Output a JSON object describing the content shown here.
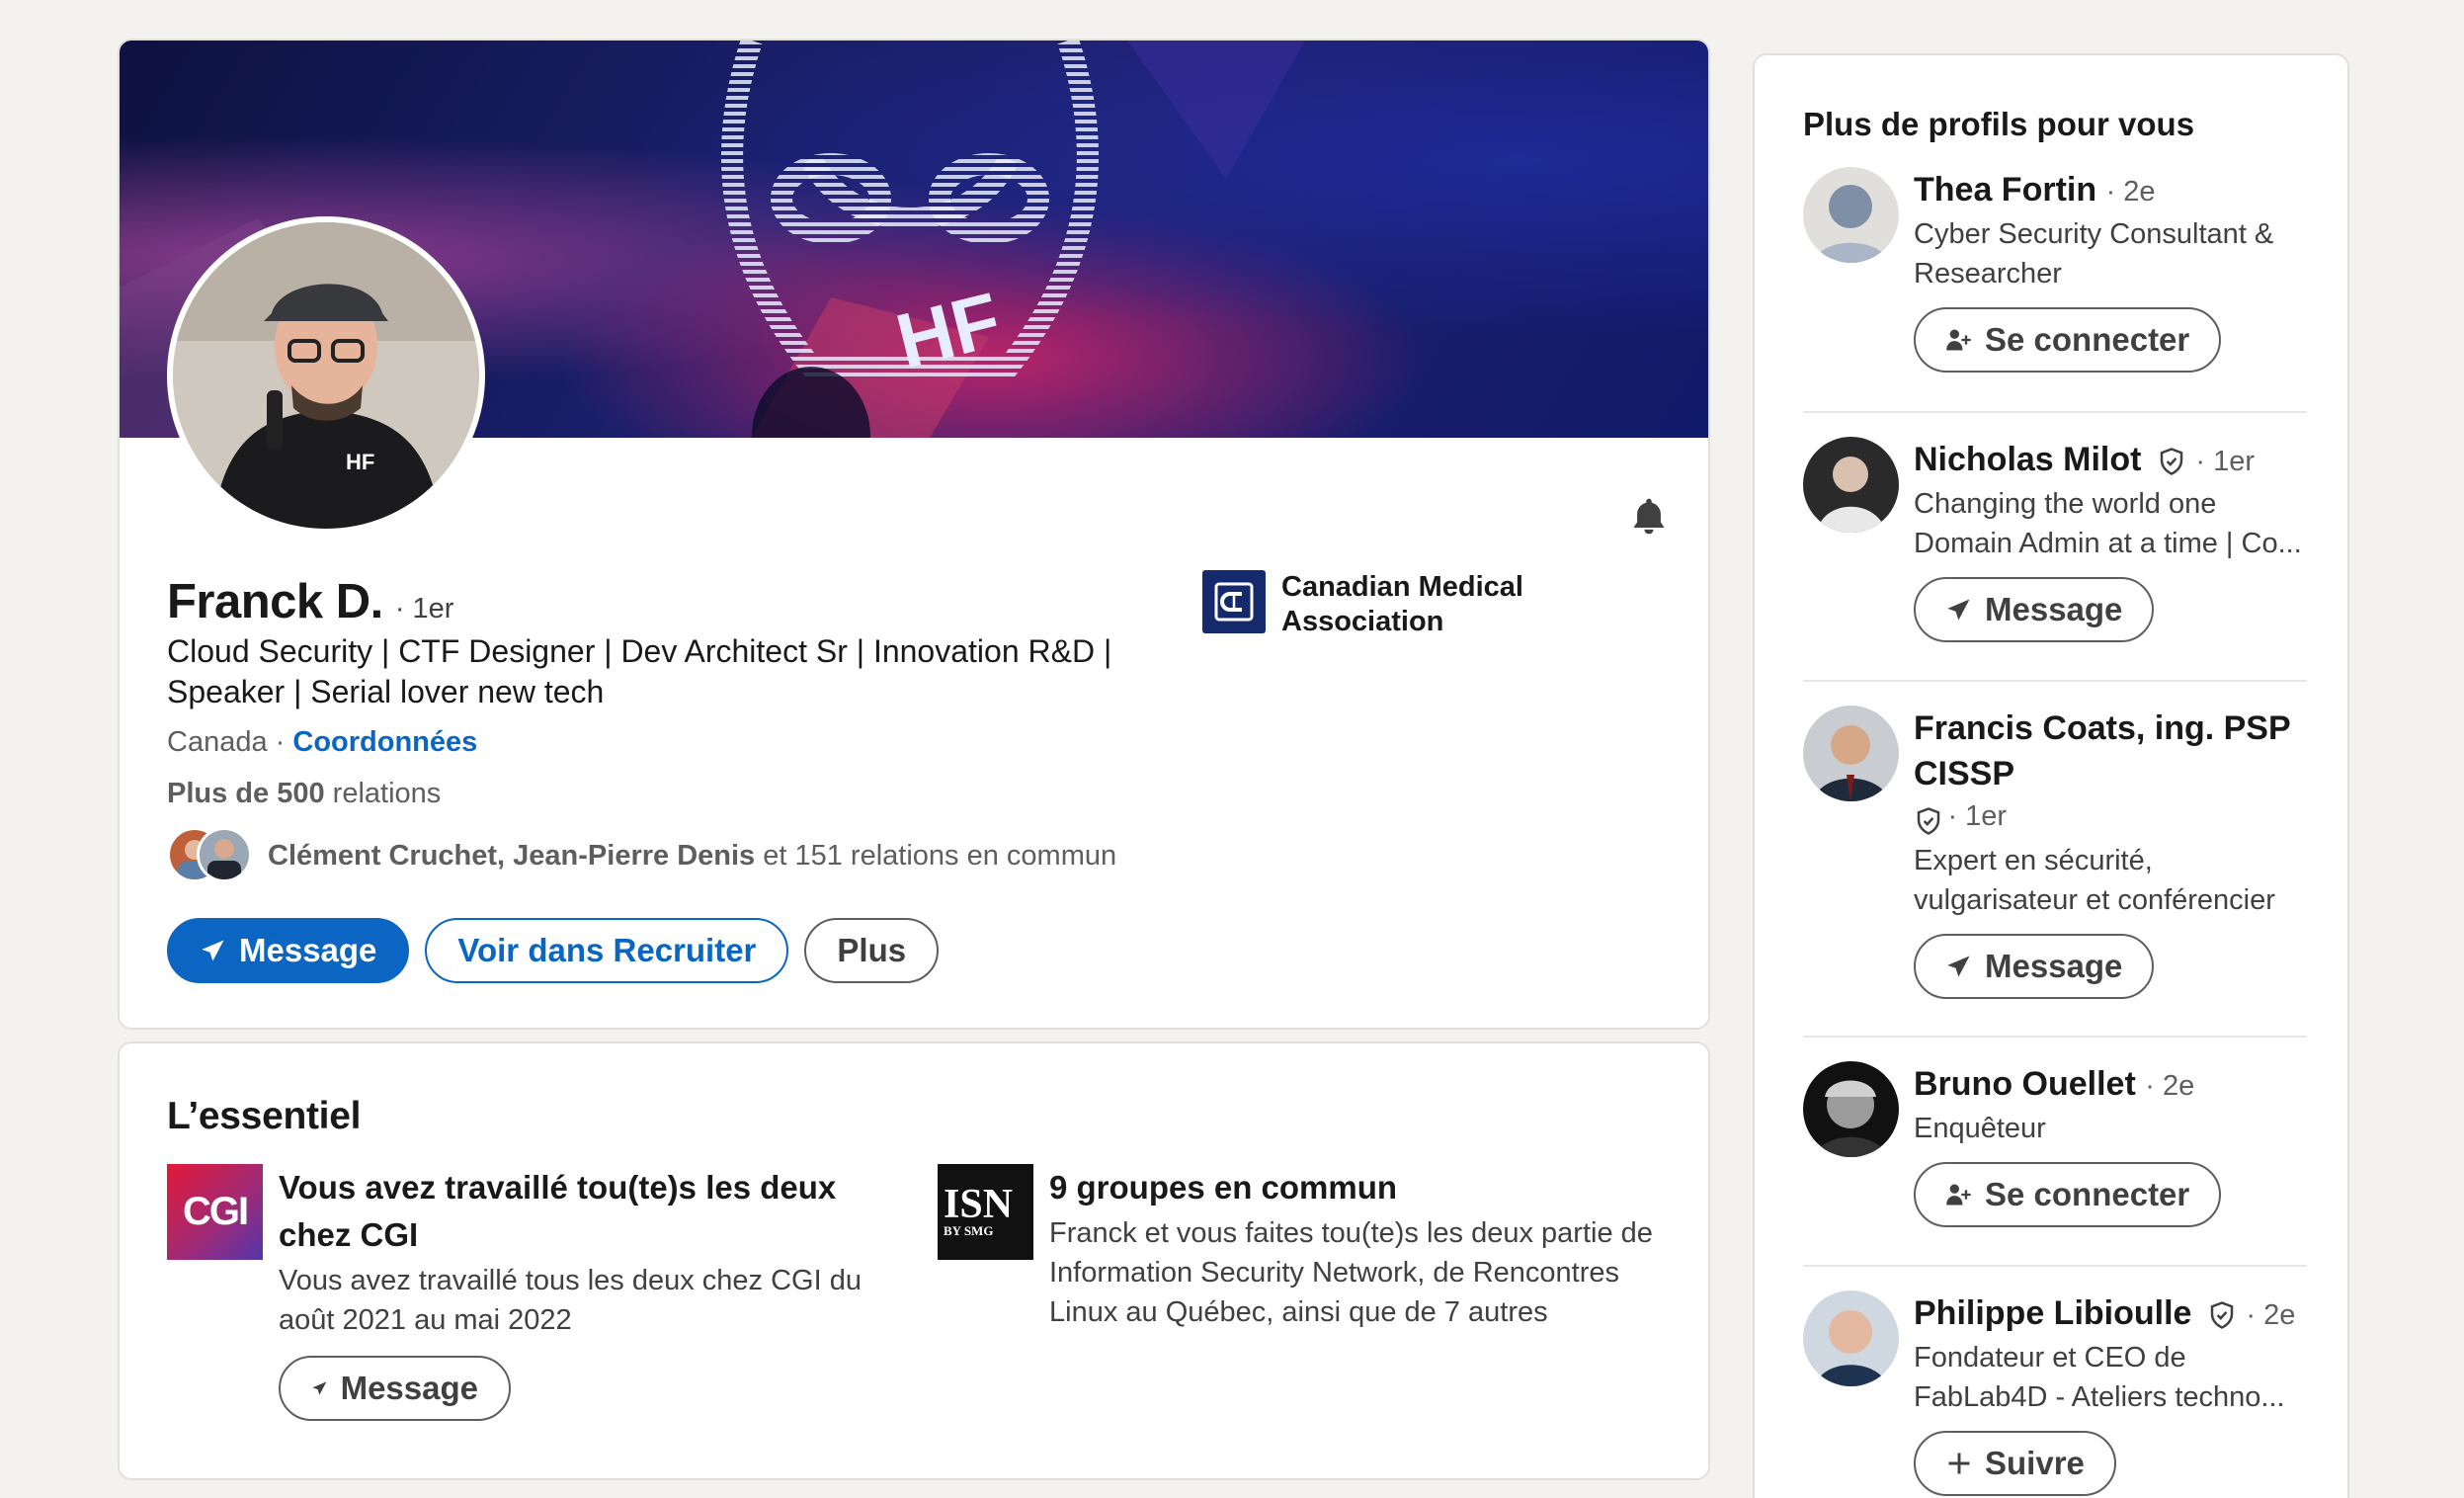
{
  "profile": {
    "name": "Franck D.",
    "degree": "· 1er",
    "headline": "Cloud Security | CTF Designer | Dev Architect Sr | Innovation R&D | Speaker | Serial lover new tech",
    "location": "Canada ·",
    "contact_link": "Coordonnées",
    "relations_bold": "Plus de 500",
    "relations_suffix": "relations",
    "mutual_names": "Clément Cruchet, Jean-Pierre Denis",
    "mutual_suffix": "et 151 relations en commun",
    "company": "Canadian Medical Association",
    "banner_text": "HF",
    "actions": {
      "message": "Message",
      "recruiter": "Voir dans Recruiter",
      "more": "Plus"
    }
  },
  "essentials": {
    "title": "L’essentiel",
    "items": [
      {
        "logo_text": "CGI",
        "heading": "Vous avez travaillé tou(te)s les deux chez CGI",
        "description": "Vous avez travaillé tous les deux chez CGI du août 2021 au mai 2022",
        "button": "Message"
      },
      {
        "logo_text": "ISN",
        "logo_subtext": "BY SMG",
        "heading": "9 groupes en commun",
        "description": "Franck et vous faites tou(te)s les deux partie de Information Security Network, de Rencontres Linux au Québec, ainsi que de 7 autres"
      }
    ]
  },
  "sidebar": {
    "title": "Plus de profils pour vous",
    "people": [
      {
        "name": "Thea Fortin",
        "degree": "· 2e",
        "description": "Cyber Security Consultant & Researcher",
        "button": "Se connecter",
        "button_icon": "add-person-icon",
        "verified": false
      },
      {
        "name": "Nicholas Milot",
        "degree": "· 1er",
        "description": "Changing the world one Domain Admin at a time | Co...",
        "button": "Message",
        "button_icon": "send-icon",
        "verified": true
      },
      {
        "name": "Francis Coats, ing. PSP CISSP",
        "degree": "· 1er",
        "description": "Expert en sécurité, vulgarisateur et conférencier",
        "button": "Message",
        "button_icon": "send-icon",
        "verified": true
      },
      {
        "name": "Bruno Ouellet",
        "degree": "· 2e",
        "description": "Enquêteur",
        "button": "Se connecter",
        "button_icon": "add-person-icon",
        "verified": false
      },
      {
        "name": "Philippe Libioulle",
        "degree": "· 2e",
        "description": "Fondateur et CEO de FabLab4D - Ateliers techno...",
        "button": "Suivre",
        "button_icon": "plus-icon",
        "verified": true
      }
    ]
  },
  "colors": {
    "accent": "#0a66c2",
    "background": "#f4f2ee",
    "text": "#191919",
    "muted": "#5e5e5e"
  }
}
